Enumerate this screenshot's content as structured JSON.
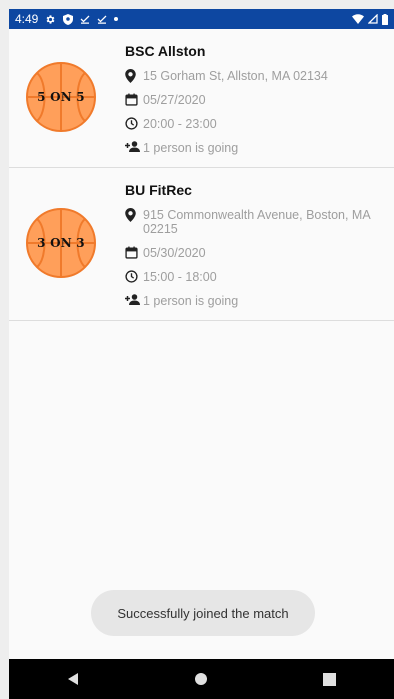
{
  "status_bar": {
    "time": "4:49",
    "left_icons": [
      "settings-icon",
      "shield-icon",
      "download-done-icon",
      "download-done-icon",
      "dot-icon"
    ],
    "right_icons": [
      "wifi-icon",
      "signal-icon",
      "battery-icon"
    ]
  },
  "matches": [
    {
      "badge": "5 ON 5",
      "venue": "BSC Allston",
      "address": "15 Gorham St, Allston, MA 02134",
      "date": "05/27/2020",
      "time": "20:00 - 23:00",
      "going": "1 person is going"
    },
    {
      "badge": "3 ON 3",
      "venue": "BU FitRec",
      "address": "915 Commonwealth Avenue, Boston, MA 02215",
      "date": "05/30/2020",
      "time": "15:00 - 18:00",
      "going": "1 person is going"
    }
  ],
  "toast": {
    "message": "Successfully joined the match"
  },
  "nav": [
    "back-icon",
    "home-icon",
    "recents-icon"
  ],
  "colors": {
    "status_bar": "#0d47a1",
    "ball": "#ff9f5a",
    "ball_lines": "#f07a2b",
    "muted_text": "#9e9e9e"
  }
}
